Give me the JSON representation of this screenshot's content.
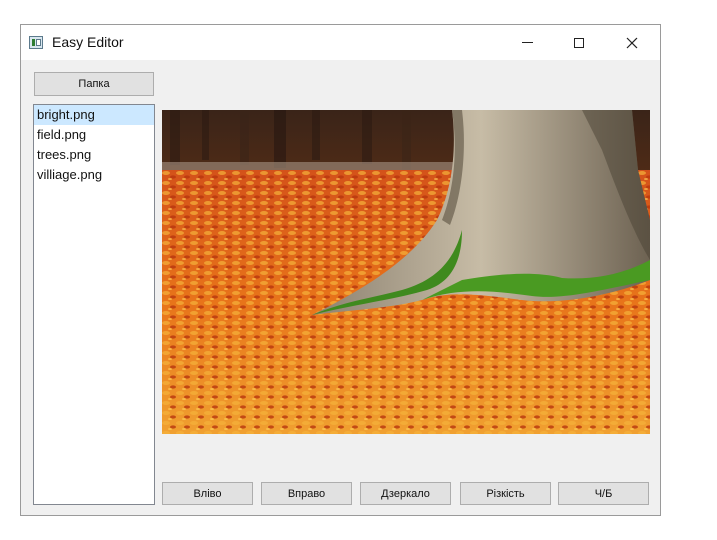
{
  "window": {
    "title": "Easy Editor",
    "controls": [
      "minimize",
      "maximize",
      "close"
    ]
  },
  "sidebar": {
    "folder_button_label": "Папка",
    "files": [
      "bright.png",
      "field.png",
      "trees.png",
      "villiage.png"
    ],
    "selected_file": "bright.png"
  },
  "preview": {
    "description_icon": "image-preview"
  },
  "toolbar": {
    "left_label": "Вліво",
    "right_label": "Вправо",
    "mirror_label": "Дзеркало",
    "sharpness_label": "Різкість",
    "bw_label": "Ч/Б"
  },
  "colors": {
    "selection": "#cce8ff",
    "button_face": "#e1e1e1",
    "window_bg": "#f0f0f0"
  }
}
